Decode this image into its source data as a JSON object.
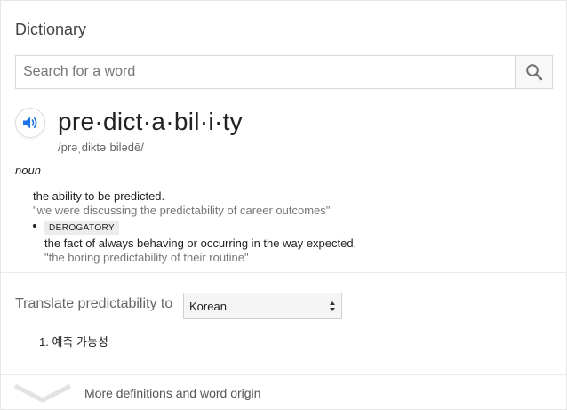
{
  "header": {
    "title": "Dictionary"
  },
  "search": {
    "placeholder": "Search for a word",
    "value": "",
    "button_icon": "search-icon"
  },
  "entry": {
    "audio_icon": "speaker-icon",
    "headword": "pre·dict·a·bil·i·ty",
    "phonetic": "/prəˌdiktəˈbilədē/",
    "part_of_speech": "noun",
    "senses": [
      {
        "label": "",
        "definition": "the ability to be predicted.",
        "example": "\"we were discussing the predictability of career outcomes\""
      },
      {
        "label": "DEROGATORY",
        "definition": "the fact of always behaving or occurring in the way expected.",
        "example": "\"the boring predictability of their routine\""
      }
    ]
  },
  "translate": {
    "label": "Translate predictability to",
    "selected_language": "Korean",
    "results": [
      "1. 예측 가능성"
    ]
  },
  "footer": {
    "more_label": "More definitions and word origin",
    "icon": "chevron-down-icon"
  },
  "colors": {
    "accent": "#1a73e8",
    "text": "#222222",
    "muted": "#777777",
    "border": "#d9d9d9"
  }
}
